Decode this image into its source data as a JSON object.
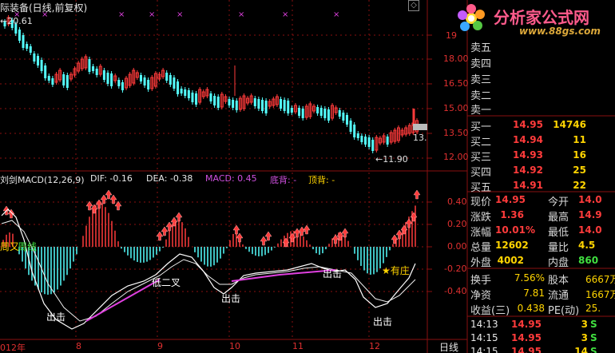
{
  "chart_title": "际装备(日线,前复权)",
  "logo": {
    "brand": "分析家公式网",
    "url": "www.88gs.com"
  },
  "price_axis": [
    "19",
    "18.00",
    "16.50",
    "15.00",
    "13.50",
    "12.00"
  ],
  "price_marks": {
    "high_label": "20.61",
    "low_label": "11.90",
    "last_tag": "13."
  },
  "indicator": {
    "name": "刘剑MACD(12,26,9)",
    "dif": "DIF: -0.16",
    "dea": "DEA: -0.38",
    "macd": "MACD: 0.45",
    "bottom_div": "底背: -",
    "top_div": "顶背: -"
  },
  "indicator_axis": [
    "0.40",
    "0.20",
    "0.00",
    "-0.20",
    "-0.40"
  ],
  "annotations": {
    "zhou_left": "周又",
    "zhou_right": "周线",
    "golden_cross": "低二叉",
    "exit1": "出击",
    "exit2": "出击",
    "exit3": "出击",
    "exit4": "出击",
    "zhuang": "★有庄"
  },
  "time_axis": [
    "012年",
    "8",
    "9",
    "10",
    "11",
    "12"
  ],
  "period_label": "日线",
  "order_book": {
    "sells": [
      {
        "label": "卖五"
      },
      {
        "label": "卖四"
      },
      {
        "label": "卖三"
      },
      {
        "label": "卖二"
      },
      {
        "label": "卖一"
      }
    ],
    "buys": [
      {
        "label": "买一",
        "price": "14.95",
        "vol": "14746"
      },
      {
        "label": "买二",
        "price": "14.94",
        "vol": "11"
      },
      {
        "label": "买三",
        "price": "14.93",
        "vol": "16"
      },
      {
        "label": "买四",
        "price": "14.92",
        "vol": "25"
      },
      {
        "label": "买五",
        "price": "14.91",
        "vol": "22"
      }
    ]
  },
  "stats": [
    {
      "l1": "现价",
      "v1": "14.95",
      "l2": "今开",
      "v2": "14.0"
    },
    {
      "l1": "涨跌",
      "v1": "1.36",
      "l2": "最高",
      "v2": "14.9"
    },
    {
      "l1": "涨幅",
      "v1": "10.01%",
      "l2": "最低",
      "v2": "14.0"
    },
    {
      "l1": "总量",
      "v1": "12602",
      "l2": "量比",
      "v2": "4.5"
    },
    {
      "l1": "外盘",
      "v1": "4002",
      "l2": "内盘",
      "v2": "860"
    }
  ],
  "stats2": [
    {
      "l1": "换手",
      "v1": "7.56%",
      "l2": "股本",
      "v2": "6667万"
    },
    {
      "l1": "净资",
      "v1": "7.81",
      "l2": "流通",
      "v2": "1667万"
    },
    {
      "l1": "收益(三)",
      "v1": "0.438",
      "l2": "PE(动)",
      "v2": "25."
    }
  ],
  "ticks": [
    {
      "time": "14:13",
      "price": "14.95",
      "vol": "3",
      "side": "S"
    },
    {
      "time": "14:15",
      "price": "14.95",
      "vol": "3",
      "side": "S"
    },
    {
      "time": "14:15",
      "price": "14.95",
      "vol": "14",
      "side": "S"
    }
  ],
  "colors": {
    "up": "#ff3b3b",
    "down": "#54ffff",
    "yellow": "#ffd400",
    "magenta": "#e040e0",
    "grid": "#8a1010"
  }
}
